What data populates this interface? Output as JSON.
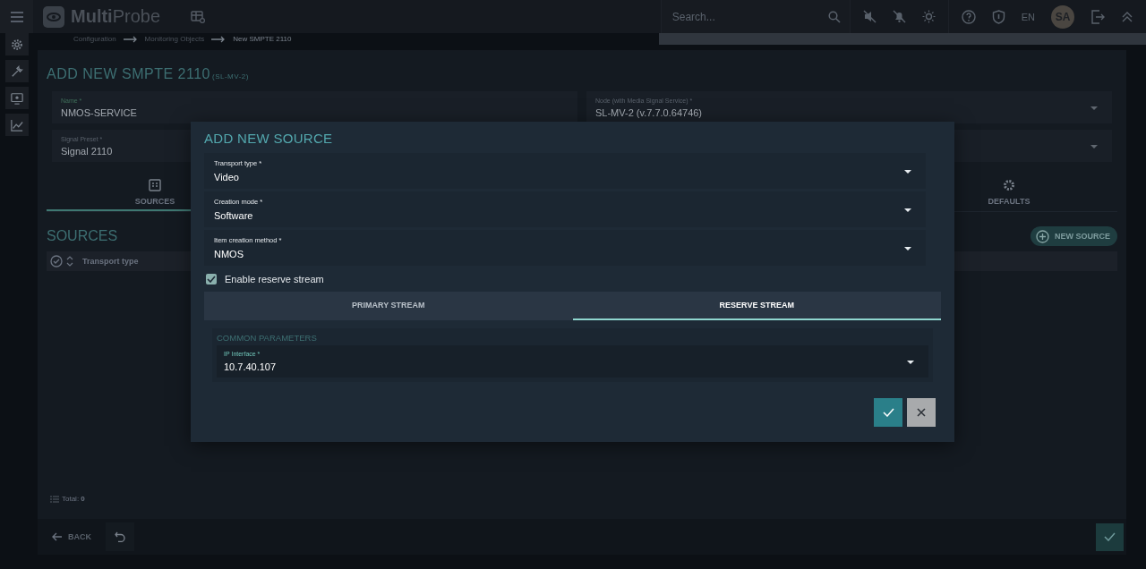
{
  "app": {
    "name_bold": "Multi",
    "name_light": "Probe"
  },
  "search": {
    "placeholder": "Search..."
  },
  "language": "EN",
  "avatar": "SA",
  "breadcrumbs": [
    "Configuration",
    "Monitoring Objects",
    "New SMPTE 2110"
  ],
  "page": {
    "title": "ADD NEW SMPTE 2110",
    "subtitle": "(SL-MV-2)"
  },
  "fields": [
    {
      "label": "Name *",
      "value": "NMOS-SERVICE",
      "kind": "text"
    },
    {
      "label": "Node (with Media Signal Service) *",
      "value": "SL-MV-2 (v.7.7.0.64746)",
      "kind": "select"
    },
    {
      "label": "Signal Preset *",
      "value": "Signal 2110",
      "kind": "select"
    }
  ],
  "tabs": [
    {
      "label": "SOURCES",
      "selected": true
    },
    {
      "label": "DEFAULTS",
      "selected": false
    }
  ],
  "sources": {
    "title": "SOURCES",
    "new_button": "NEW SOURCE",
    "columns": [
      "Transport type"
    ],
    "total_label": "Total:",
    "total": "0"
  },
  "footer": {
    "back": "BACK"
  },
  "modal": {
    "title": "ADD NEW SOURCE",
    "fields": [
      {
        "label": "Transport type *",
        "value": "Video"
      },
      {
        "label": "Creation mode *",
        "value": "Software"
      },
      {
        "label": "Item creation method *",
        "value": "NMOS"
      }
    ],
    "reserve": {
      "label": "Enable reserve stream",
      "checked": true
    },
    "stream_tabs": [
      {
        "label": "PRIMARY STREAM",
        "selected": false
      },
      {
        "label": "RESERVE STREAM",
        "selected": true
      }
    ],
    "section": "COMMON PARAMETERS",
    "ip": {
      "label": "IP Interface *",
      "value": "10.7.40.107"
    }
  }
}
